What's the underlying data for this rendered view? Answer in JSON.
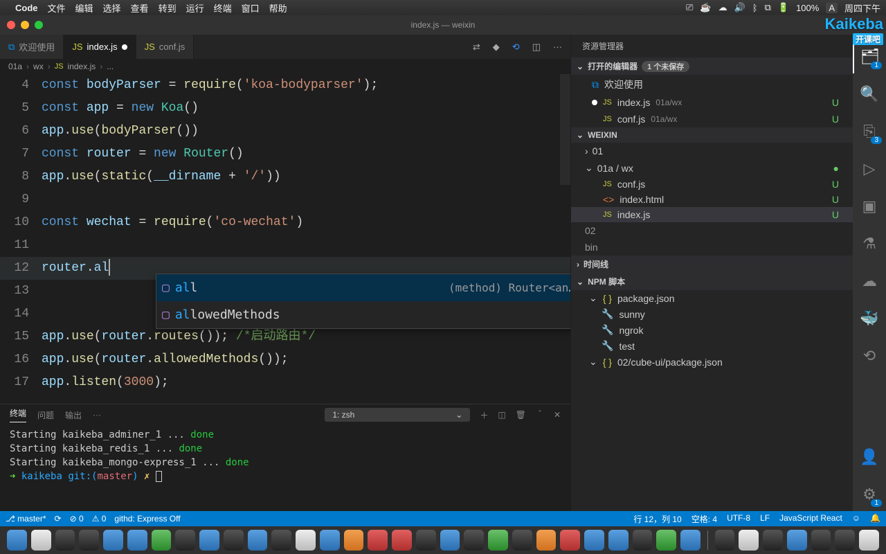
{
  "menubar": {
    "app": "Code",
    "items": [
      "文件",
      "编辑",
      "选择",
      "查看",
      "转到",
      "运行",
      "终端",
      "窗口",
      "帮助"
    ],
    "battery": "100%",
    "clock": "周四下午"
  },
  "titlebar": {
    "title": "index.js — weixin"
  },
  "tabs": {
    "welcome": "欢迎使用",
    "index": "index.js",
    "conf": "conf.js"
  },
  "breadcrumb": {
    "a": "01a",
    "b": "wx",
    "c": "index.js",
    "d": "..."
  },
  "code": {
    "lines": [
      {
        "n": 4,
        "html": "<span class='k-const'>const</span> <span class='k-var'>bodyParser</span> = <span class='k-fn'>require</span>(<span class='k-str'>'koa-bodyparser'</span>);"
      },
      {
        "n": 5,
        "html": "<span class='k-const'>const</span> <span class='k-var'>app</span> = <span class='k-new'>new</span> <span class='k-type'>Koa</span>()"
      },
      {
        "n": 6,
        "html": "<span class='k-var'>app</span>.<span class='k-fn'>use</span>(<span class='k-fn'>bodyParser</span>())"
      },
      {
        "n": 7,
        "html": "<span class='k-const'>const</span> <span class='k-var'>router</span> = <span class='k-new'>new</span> <span class='k-type'>Router</span>()"
      },
      {
        "n": 8,
        "html": "<span class='k-var'>app</span>.<span class='k-fn'>use</span>(<span class='k-fn'>static</span>(<span class='k-var'>__dirname</span> + <span class='k-str'>'/'</span>))"
      },
      {
        "n": 9,
        "html": ""
      },
      {
        "n": 10,
        "html": "<span class='k-const'>const</span> <span class='k-var'>wechat</span> = <span class='k-fn'>require</span>(<span class='k-str'>'co-wechat'</span>)"
      },
      {
        "n": 11,
        "html": ""
      },
      {
        "n": 12,
        "html": "<span class='k-var'>router</span>.<span class='k-prop'>al</span><span class='cursor'></span>"
      },
      {
        "n": 13,
        "html": ""
      },
      {
        "n": 14,
        "html": ""
      },
      {
        "n": 15,
        "html": "<span class='k-var'>app</span>.<span class='k-fn'>use</span>(<span class='k-var'>router</span>.<span class='k-fn'>routes</span>()); <span class='k-comment'>/*启动路由*/</span>"
      },
      {
        "n": 16,
        "html": "<span class='k-var'>app</span>.<span class='k-fn'>use</span>(<span class='k-var'>router</span>.<span class='k-fn'>allowedMethods</span>());"
      },
      {
        "n": 17,
        "html": "<span class='k-var'>app</span>.<span class='k-fn'>listen</span>(<span class='k-str'>3000</span>);"
      }
    ]
  },
  "autocomplete": {
    "hint": "(method) Router<an…",
    "row1_pre": "al",
    "row1_match": "l",
    "row2_pre": "al",
    "row2_match": "l",
    "row2_rest": "owedMethods"
  },
  "panel": {
    "tabs": {
      "terminal": "终端",
      "problems": "问题",
      "output": "输出",
      "more": "···"
    },
    "shell": "1: zsh",
    "lines": [
      {
        "t": "Starting kaikeba_adminer_1       ... ",
        "done": "done"
      },
      {
        "t": "Starting kaikeba_redis_1         ... ",
        "done": "done"
      },
      {
        "t": "Starting kaikeba_mongo-express_1 ... ",
        "done": "done"
      }
    ],
    "prompt": {
      "arrow": "➜",
      "path": "kaikeba",
      "gitl": "git:(",
      "branch": "master",
      "gitr": ")",
      "x": "✗"
    }
  },
  "explorer": {
    "title": "资源管理器",
    "open_editors": "打开的编辑器",
    "unsaved": "1 个未保存",
    "welcome": "欢迎使用",
    "index": "index.js",
    "index_path": "01a/wx",
    "conf": "conf.js",
    "conf_path": "01a/wx",
    "project": "WEIXIN",
    "folders": {
      "f01": "01",
      "f01a": "01a / wx"
    },
    "files": {
      "conf": "conf.js",
      "html": "index.html",
      "index": "index.js"
    },
    "peek": {
      "a": "02",
      "b": "bin"
    },
    "timeline": "时间线",
    "npm": "NPM 脚本",
    "pkg": "package.json",
    "scripts": [
      "sunny",
      "ngrok",
      "test"
    ],
    "pkg2": "02/cube-ui/package.json",
    "u": "U"
  },
  "status": {
    "branch": "master*",
    "sync": "⟳",
    "err": "⊘ 0",
    "warn": "⚠ 0",
    "githd": "githd: Express Off",
    "pos": "行 12，列 10",
    "spaces": "空格: 4",
    "enc": "UTF-8",
    "eol": "LF",
    "lang": "JavaScript React",
    "bell": "🔔"
  },
  "activity_badges": {
    "files": "1",
    "scm": "3",
    "settings": "1"
  },
  "watermark": {
    "brand": "Kaikeba",
    "sub": "开课吧"
  }
}
